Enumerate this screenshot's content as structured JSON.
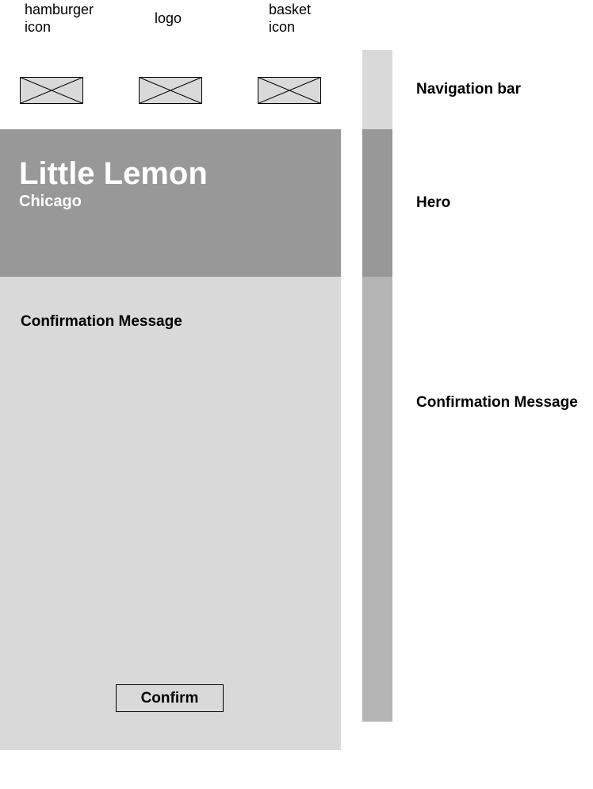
{
  "header": {
    "hamburger_label_line1": "hamburger",
    "hamburger_label_line2": "icon",
    "logo_label": "logo",
    "basket_label_line1": "basket",
    "basket_label_line2": "icon"
  },
  "hero": {
    "title": "Little Lemon",
    "subtitle": "Chicago"
  },
  "main": {
    "heading": "Confirmation Message",
    "confirm_label": "Confirm"
  },
  "sections": {
    "nav": "Navigation bar",
    "hero": "Hero",
    "confirmation": "Confirmation Message"
  },
  "colors": {
    "hero_bg": "#989898",
    "main_bg": "#d9d9d9",
    "nav_bar": "#d9d9d9",
    "hero_bar": "#989898",
    "confirmation_bar": "#b4b4b4",
    "placeholder_fill": "#d9d9d9"
  }
}
